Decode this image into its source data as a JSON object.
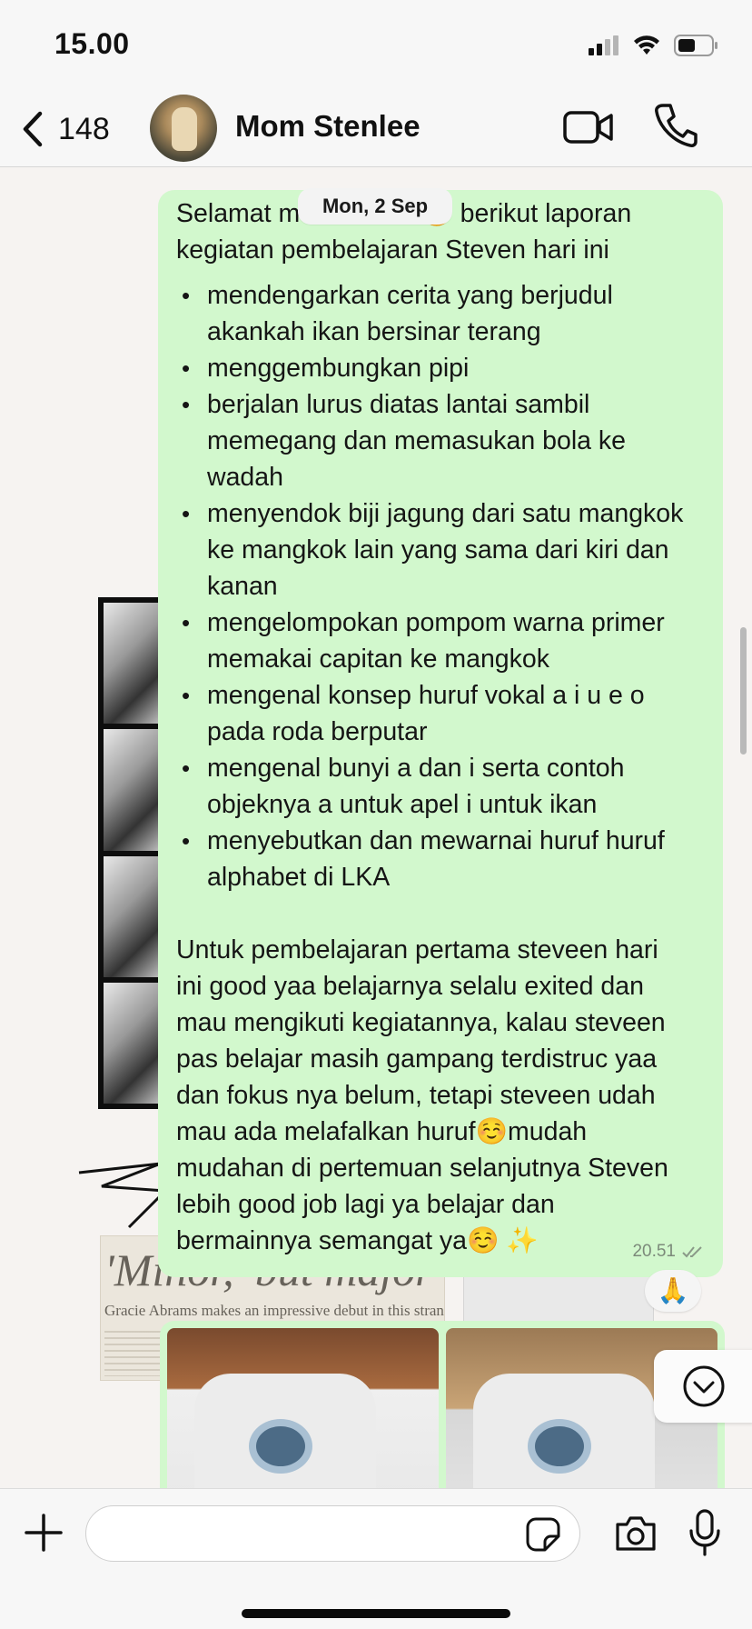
{
  "status_bar": {
    "time": "15.00",
    "icons": [
      "signal-icon",
      "wifi-icon",
      "battery-icon"
    ]
  },
  "header": {
    "back_count": "148",
    "contact_name": "Mom Stenlee",
    "icons": [
      "chevron-left-icon",
      "video-camera-icon",
      "phone-icon"
    ]
  },
  "date_separator": "Mon, 2 Sep",
  "message": {
    "intro_lines": [
      "Selamat malam mom☺️ berikut laporan",
      "kegiatan pembelajaran Steven hari ini"
    ],
    "items": [
      "mendengarkan cerita yang berjudul akankah ikan bersinar terang",
      "menggembungkan pipi",
      "berjalan lurus diatas lantai sambil memegang dan memasukan bola ke wadah",
      "menyendok biji jagung dari satu mangkok ke mangkok lain yang sama dari kiri dan kanan",
      "mengelompokan pompom warna primer memakai capitan ke mangkok",
      "mengenal konsep huruf vokal a i u e o pada roda berputar",
      "mengenal bunyi a dan i serta contoh objeknya a untuk apel i untuk ikan",
      "menyebutkan dan mewarnai huruf huruf alphabet di LKA"
    ],
    "closing_lines": [
      "Untuk pembelajaran pertama steveen hari",
      "ini good yaa belajarnya selalu exited dan",
      "mau mengikuti kegiatannya, kalau steveen",
      "pas belajar masih gampang terdistruc yaa",
      "dan fokus nya belum, tetapi steveen udah",
      "mau ada melafalkan huruf☺️mudah",
      "mudahan di pertemuan selanjutnya Steven",
      "lebih good job lagi ya belajar dan",
      "bermainnya semangat ya☺️ ✨"
    ],
    "time": "20.51",
    "read_status_icon": "double-check-icon"
  },
  "reaction": "🙏",
  "wallpaper": {
    "newspaper_headline": "'Minor,' but major",
    "newspaper_subline": "Gracie Abrams makes an impressive debut in this strange time"
  },
  "composer": {
    "placeholder": "",
    "icons": [
      "plus-icon",
      "sticker-icon",
      "camera-icon",
      "microphone-icon"
    ]
  },
  "colors": {
    "bubble": "#d2f8cd",
    "background": "#f6f3f1",
    "bar": "#f7f7f7"
  }
}
